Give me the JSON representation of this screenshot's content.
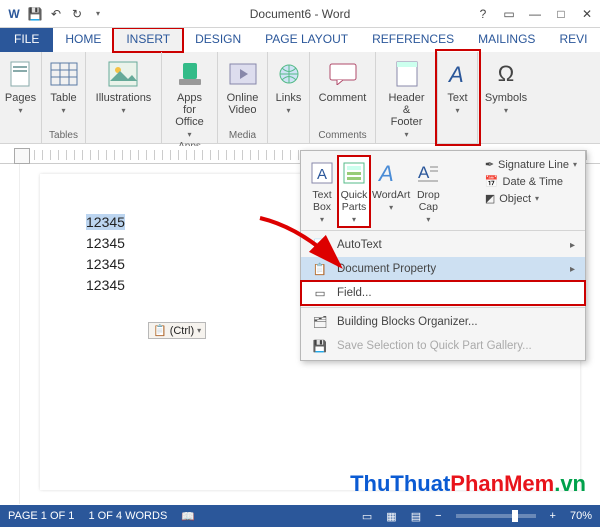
{
  "window": {
    "title": "Document6 - Word"
  },
  "qat": {
    "word": "W",
    "save": "💾",
    "undo": "↶",
    "redo": "↷"
  },
  "tabs": {
    "file": "FILE",
    "home": "HOME",
    "insert": "INSERT",
    "design": "DESIGN",
    "page_layout": "PAGE LAYOUT",
    "references": "REFERENCES",
    "mailings": "MAILINGS",
    "review": "REVI"
  },
  "ribbon": {
    "pages": {
      "label": "Pages",
      "group": ""
    },
    "tables": {
      "label": "Table",
      "group": "Tables"
    },
    "illustrations": {
      "label": "Illustrations",
      "group": ""
    },
    "apps": {
      "label": "Apps for\nOffice",
      "group": "Apps"
    },
    "media": {
      "label": "Online\nVideo",
      "group": "Media"
    },
    "links": {
      "label": "Links",
      "group": ""
    },
    "comment": {
      "label": "Comment",
      "group": "Comments"
    },
    "header_footer": {
      "label": "Header &\nFooter",
      "group": ""
    },
    "text": {
      "label": "Text",
      "group": ""
    },
    "symbols": {
      "label": "Symbols",
      "group": ""
    }
  },
  "document": {
    "lines": [
      "12345",
      "12345",
      "12345",
      "12345"
    ],
    "paste_options": "(Ctrl)"
  },
  "text_panel": {
    "text_box": "Text\nBox",
    "quick_parts": "Quick\nParts",
    "wordart": "WordArt",
    "drop_cap": "Drop\nCap",
    "signature_line": "Signature Line",
    "date_time": "Date & Time",
    "object": "Object"
  },
  "quick_parts_menu": {
    "autotext": "AutoText",
    "document_property": "Document Property",
    "field": "Field...",
    "building_blocks": "Building Blocks Organizer...",
    "save_selection": "Save Selection to Quick Part Gallery..."
  },
  "status": {
    "page": "PAGE 1 OF 1",
    "words": "1 OF 4 WORDS",
    "zoom": "70%"
  },
  "watermark": {
    "t1": "ThuThuat",
    "t2": "PhanMem",
    "t3": ".vn"
  }
}
